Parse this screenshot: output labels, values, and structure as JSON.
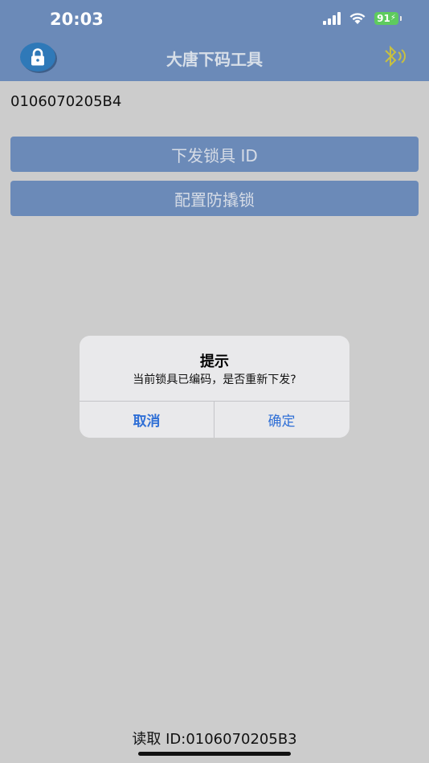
{
  "status_bar": {
    "time": "20:03",
    "battery": "91"
  },
  "header": {
    "title": "大唐下码工具",
    "logo_icon": "lock-icon",
    "bluetooth_icon": "bluetooth-icon"
  },
  "main": {
    "current_id": "0106070205B4",
    "buttons": [
      {
        "label": "下发锁具 ID"
      },
      {
        "label": "配置防撬锁"
      }
    ]
  },
  "dialog": {
    "title": "提示",
    "message": "当前锁具已编码，是否重新下发?",
    "cancel_label": "取消",
    "confirm_label": "确定"
  },
  "footer": {
    "read_id": "读取 ID:0106070205B3"
  },
  "colors": {
    "header_bg": "#6b8ab8",
    "page_bg": "#cccccc",
    "dialog_button": "#2f6fd6",
    "bluetooth": "#c8c040"
  }
}
